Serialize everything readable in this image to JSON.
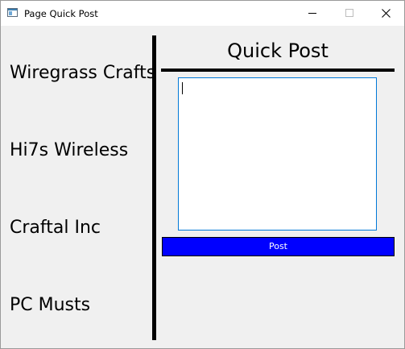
{
  "window": {
    "title": "Page Quick Post",
    "icon": "app-window-icon",
    "controls": {
      "minimize_icon": "minimize-icon",
      "maximize_icon": "maximize-icon",
      "close_icon": "close-icon"
    }
  },
  "sidebar": {
    "items": [
      {
        "label": "Wiregrass Crafts"
      },
      {
        "label": "Hi7s Wireless"
      },
      {
        "label": "Craftal Inc"
      },
      {
        "label": "PC Musts"
      }
    ]
  },
  "main": {
    "title": "Quick Post",
    "post_text": "",
    "post_button_label": "Post"
  },
  "colors": {
    "background": "#f0f0f0",
    "titlebar": "#ffffff",
    "post_button_bg": "#0000ff",
    "post_button_text": "#ffffff",
    "textarea_border": "#0078d7",
    "divider": "#000000"
  }
}
